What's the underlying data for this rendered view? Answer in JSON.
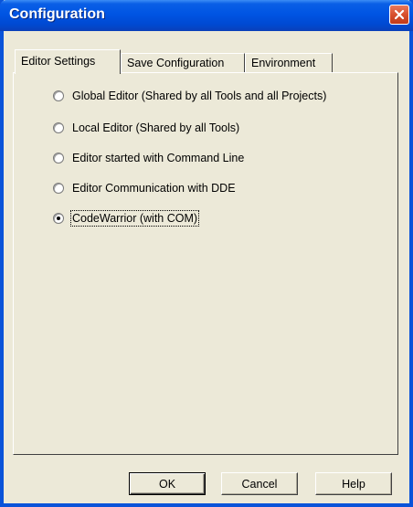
{
  "window": {
    "title": "Configuration"
  },
  "tabs": [
    {
      "label": "Editor Settings",
      "active": true
    },
    {
      "label": "Save Configuration",
      "active": false
    },
    {
      "label": "Environment",
      "active": false
    }
  ],
  "editor_options": [
    {
      "label": "Global Editor (Shared by all Tools and all Projects)",
      "checked": false
    },
    {
      "label": "Local Editor (Shared by all Tools)",
      "checked": false
    },
    {
      "label": "Editor started with Command Line",
      "checked": false
    },
    {
      "label": "Editor Communication with DDE",
      "checked": false
    },
    {
      "label": "CodeWarrior (with COM)",
      "checked": true
    }
  ],
  "buttons": {
    "ok": "OK",
    "cancel": "Cancel",
    "help": "Help"
  },
  "icons": {
    "close": "close-icon",
    "radio": "radio-button-icon"
  },
  "colors": {
    "titlebar": "#0054e3",
    "window_bg": "#ece9d8",
    "close_button": "#d8502d"
  }
}
